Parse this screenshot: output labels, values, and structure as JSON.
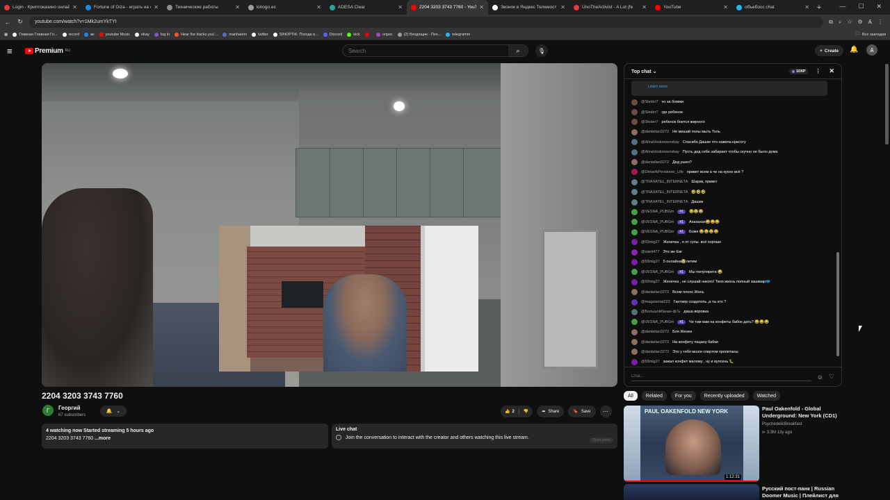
{
  "browser": {
    "tabs": [
      {
        "title": "Login - Криптоказино онлайн",
        "color": "#e53935"
      },
      {
        "title": "Fortune of Giza - играть на о",
        "color": "#1e88e5"
      },
      {
        "title": "Технические работы",
        "color": "#8e8e8e"
      },
      {
        "title": "kinogo.ec",
        "color": "#9e9e9e"
      },
      {
        "title": "ADESA Clear",
        "color": "#26a69a"
      },
      {
        "title": "2204 3203 3743 7760 - YouTube",
        "color": "#ff0000",
        "active": true
      },
      {
        "title": "Звонок в Яндекс Телемост",
        "color": "#ffffff"
      },
      {
        "title": "UnoTheActivist - A Lot (fe",
        "color": "#e53935"
      },
      {
        "title": "YouTube",
        "color": "#ff0000"
      },
      {
        "title": "объебосс chat",
        "color": "#29b6f6"
      }
    ],
    "url": "youtube.com/watch?v=1Mk2umYkTYI",
    "bookmarks": [
      {
        "label": "Главная Главная Гл...",
        "color": "#ffffff"
      },
      {
        "label": "record",
        "color": "#ffffff"
      },
      {
        "label": "вк",
        "color": "#1e88e5"
      },
      {
        "label": "youtube Music",
        "color": "#ff0000"
      },
      {
        "label": "ebay",
        "color": "#ffffff"
      },
      {
        "label": "log in",
        "color": "#7e57c2"
      },
      {
        "label": "Hear the tracks you'...",
        "color": "#ff5722"
      },
      {
        "label": "manhaeim",
        "color": "#5c6bc0"
      },
      {
        "label": "twitter",
        "color": "#ffffff"
      },
      {
        "label": "SINOPTIK: Погода в...",
        "color": "#ffffff"
      },
      {
        "label": "Discord",
        "color": "#5865f2"
      },
      {
        "label": "kick",
        "color": "#53fc18"
      },
      {
        "label": "",
        "color": "#ff0000"
      },
      {
        "label": "опрос",
        "color": "#ab47bc"
      },
      {
        "label": "(2) Входящие - Поч...",
        "color": "#9e9e9e"
      },
      {
        "label": "telegramm",
        "color": "#29b6f6"
      }
    ],
    "all_bookmarks": "Все закладки"
  },
  "yt": {
    "logo_text": "Premium",
    "logo_region": "RU",
    "search_placeholder": "Search",
    "create_label": "Create"
  },
  "video": {
    "title": "2204 3203 3743 7760",
    "channel": "Георгий",
    "channel_initial": "Г",
    "subscribers": "67 subscribers",
    "likes": "2",
    "share": "Share",
    "save": "Save",
    "description_line1": "4 watching now  Started streaming 5 hours ago",
    "description_line2": "2204 3203 3743 7760",
    "more": "...more",
    "livechat_title": "Live chat",
    "livechat_text": "Join the conversation to interact with the creator and others watching this live stream.",
    "livechat_opt": "Open panel"
  },
  "chat": {
    "header": "Top chat",
    "xp": "10XP",
    "pinned_link": "Learn more",
    "input_placeholder": "Chat...",
    "messages": [
      {
        "author": "@Sleder7",
        "text": "чо за бомжи",
        "color": "#6d4c41",
        "badge": ""
      },
      {
        "author": "@Sleder7",
        "text": "где ребенок",
        "color": "#6d4c41",
        "badge": ""
      },
      {
        "author": "@Sleder7",
        "text": "ребенок боится жирного",
        "color": "#6d4c41",
        "badge": ""
      },
      {
        "author": "@dantalian3272",
        "text": "Не мешай полы мыть Толь",
        "color": "#8d6e63",
        "badge": ""
      },
      {
        "author": "@AlinaVoskresenskay",
        "text": "Спасибо Дашке что навела красоту",
        "color": "#546e7a",
        "badge": ""
      },
      {
        "author": "@AlinaVoskresenskay",
        "text": "Пусть дед себе забирает чтобы скучно не было дома",
        "color": "#546e7a",
        "badge": ""
      },
      {
        "author": "@dantalian3272",
        "text": "Дед ушел?",
        "color": "#8d6e63",
        "badge": ""
      },
      {
        "author": "@DimarikPensioner_Life",
        "text": "привет всем а че на кухне всё ?",
        "color": "#ad1457",
        "badge": ""
      },
      {
        "author": "@TRAXATEL_INTERNETA",
        "text": "Шарик, привет",
        "color": "#607d8b",
        "badge": ""
      },
      {
        "author": "@TRAXATEL_INTERNETA",
        "text": "🤣🤣🤣",
        "color": "#607d8b",
        "badge": ""
      },
      {
        "author": "@TRAXATEL_INTERNETA",
        "text": "Дашик",
        "color": "#607d8b",
        "badge": ""
      },
      {
        "author": "@VESNA_PUBGm",
        "text": "😂😂😂",
        "color": "#43a047",
        "badge": "#1"
      },
      {
        "author": "@VESNA_PUBGm",
        "text": "Ахахахах😂😂😂",
        "color": "#43a047",
        "badge": "#1"
      },
      {
        "author": "@VESNA_PUBGm",
        "text": "Боже 😂😂😂😂",
        "color": "#43a047",
        "badge": "#1"
      },
      {
        "author": "@93mig27",
        "text": "Женечка , я от супы. всё хорошо",
        "color": "#7b1fa2",
        "badge": ""
      },
      {
        "author": "@zaeti477",
        "text": "Это же Евг",
        "color": "#8e24aa",
        "badge": ""
      },
      {
        "author": "@93mig27",
        "text": "5 онлайна😭летим",
        "color": "#7b1fa2",
        "badge": ""
      },
      {
        "author": "@VESNA_PUBGm",
        "text": "Мы популярити 😂",
        "color": "#43a047",
        "badge": "#1"
      },
      {
        "author": "@93mig27",
        "text": "Женечка , не слушай никого! Твоя жизнь полный зашквар🩲",
        "color": "#7b1fa2",
        "badge": ""
      },
      {
        "author": "@dantalian3272",
        "text": "Всем плохо Жень",
        "color": "#8d6e63",
        "badge": ""
      },
      {
        "author": "@magaismat223",
        "text": "Гантвер создатель ,а ты кто ?",
        "color": "#5e35b1",
        "badge": ""
      },
      {
        "author": "@Большойбанан-ф7ь",
        "text": "даша воровка",
        "color": "#546e7a",
        "badge": ""
      },
      {
        "author": "@VESNA_PUBGm",
        "text": "Че там вам на конфеты бабок дать? 😂😂😂",
        "color": "#43a047",
        "badge": "#1"
      },
      {
        "author": "@dantalian3272",
        "text": "Бля Женек",
        "color": "#8d6e63",
        "badge": ""
      },
      {
        "author": "@dantalian3272",
        "text": "На конфету пацану бабки",
        "color": "#8d6e63",
        "badge": ""
      },
      {
        "author": "@dantalian3272",
        "text": "Это у тебя мозги спиртом пропитаны",
        "color": "#8d6e63",
        "badge": ""
      },
      {
        "author": "@93mig27",
        "text": "зажал конфет малому , ну и вупсень 🐛",
        "color": "#7b1fa2",
        "badge": ""
      }
    ]
  },
  "chips": [
    "All",
    "Related",
    "For you",
    "Recently uploaded",
    "Watched"
  ],
  "recommendations": [
    {
      "title": "Paul Oakenfold - Global Underground: New York (CD1)",
      "channel": "PsychedelicBreakfast",
      "meta": "3.3M  13y ago",
      "duration": "1:12:31",
      "thumb_text": "PAUL OAKENFOLD NEW YORK"
    },
    {
      "title": "Русский пост-панк | Russian Doomer Music | Плейлист для"
    }
  ]
}
